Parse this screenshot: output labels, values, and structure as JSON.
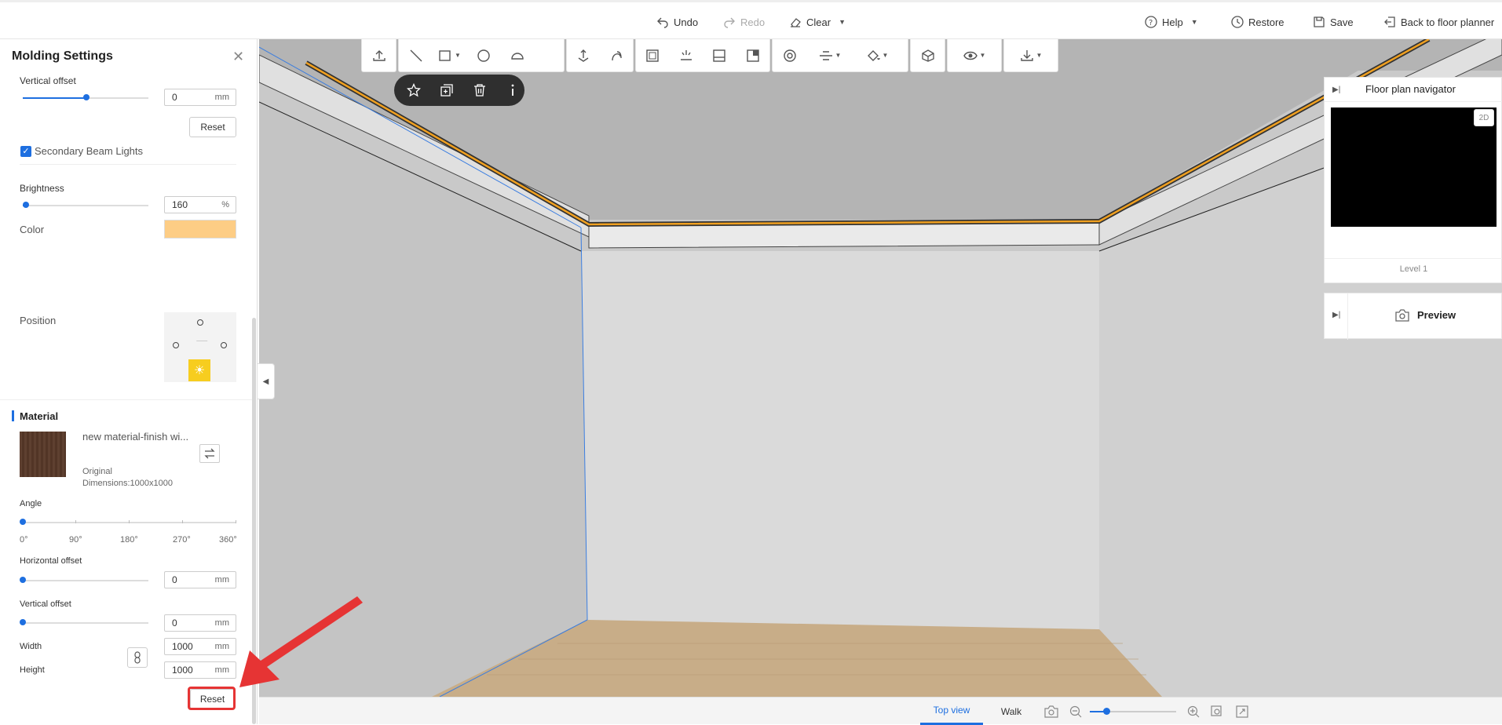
{
  "topbar": {
    "undo": "Undo",
    "redo": "Redo",
    "clear": "Clear",
    "help": "Help",
    "restore": "Restore",
    "save": "Save",
    "back": "Back to floor planner"
  },
  "panel": {
    "title": "Molding Settings",
    "vertical_offset_top": {
      "label": "Vertical offset",
      "value": "0",
      "unit": "mm",
      "slider": 0.5
    },
    "reset_top": "Reset",
    "secondary_beam_lights": "Secondary Beam Lights",
    "brightness": {
      "label": "Brightness",
      "value": "160",
      "unit": "%",
      "slider": 0.02
    },
    "color": {
      "label": "Color",
      "value": "#fdcd85"
    },
    "position": {
      "label": "Position"
    },
    "material": {
      "section": "Material",
      "name": "new material-finish wi...",
      "original": "Original",
      "dimensions": "Dimensions:1000x1000"
    },
    "angle": {
      "label": "Angle",
      "ticks": [
        "0°",
        "90°",
        "180°",
        "270°",
        "360°"
      ]
    },
    "horizontal_offset": {
      "label": "Horizontal offset",
      "value": "0",
      "unit": "mm"
    },
    "vertical_offset": {
      "label": "Vertical offset",
      "value": "0",
      "unit": "mm"
    },
    "width": {
      "label": "Width",
      "value": "1000",
      "unit": "mm"
    },
    "height": {
      "label": "Height",
      "value": "1000",
      "unit": "mm"
    },
    "reset_bottom": "Reset"
  },
  "navigator": {
    "title": "Floor plan navigator",
    "badge": "2D",
    "level": "Level 1"
  },
  "preview": {
    "label": "Preview"
  },
  "bottombar": {
    "top_view": "Top view",
    "walk": "Walk",
    "zoom": 0.18
  },
  "colors": {
    "accent": "#1e6fe0",
    "molding_light": "#f0a020",
    "annotation": "#e63434"
  }
}
